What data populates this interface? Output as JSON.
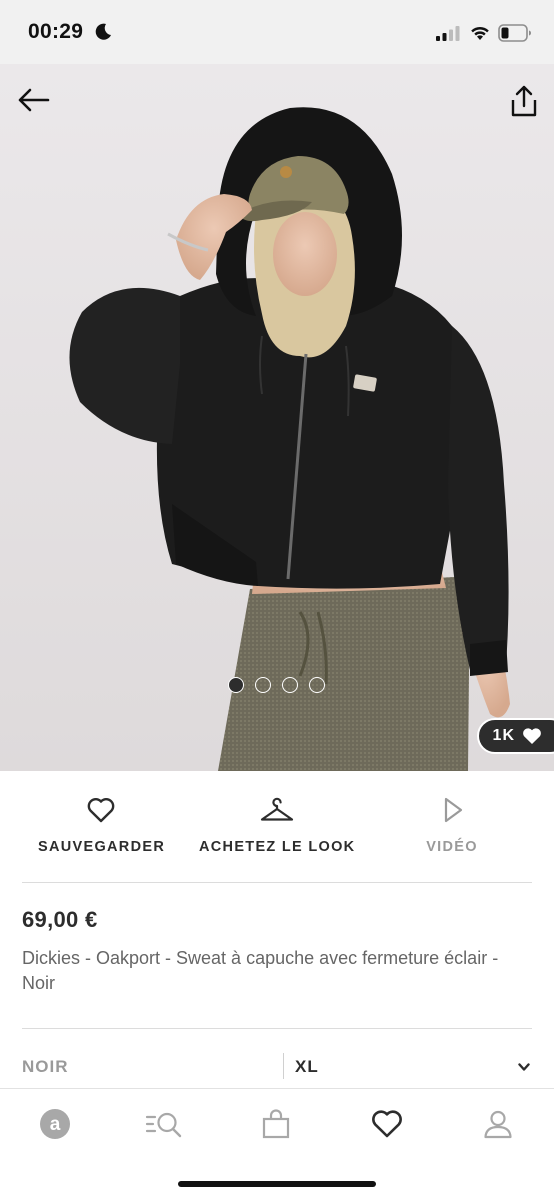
{
  "status_bar": {
    "time": "00:29"
  },
  "hero": {
    "image_count": 4,
    "active_index": 0,
    "likes": "1K"
  },
  "actions": {
    "save_label": "SAUVEGARDER",
    "look_label": "ACHETEZ LE LOOK",
    "video_label": "VIDÉO"
  },
  "product": {
    "price": "69,00 €",
    "name": "Dickies - Oakport - Sweat à capuche avec fermeture éclair - Noir"
  },
  "variant": {
    "colour": "NOIR",
    "size": "XL"
  },
  "bottom_nav": {
    "items": [
      "home-logo-icon",
      "search-icon",
      "bag-icon",
      "heart-icon",
      "profile-icon"
    ],
    "active": "heart-icon"
  },
  "colors": {
    "text_dark": "#2d2d2d",
    "text_muted": "#9a9a9a",
    "badge_bg": "#2d2d2d",
    "status_bg": "#f1f1f1"
  }
}
